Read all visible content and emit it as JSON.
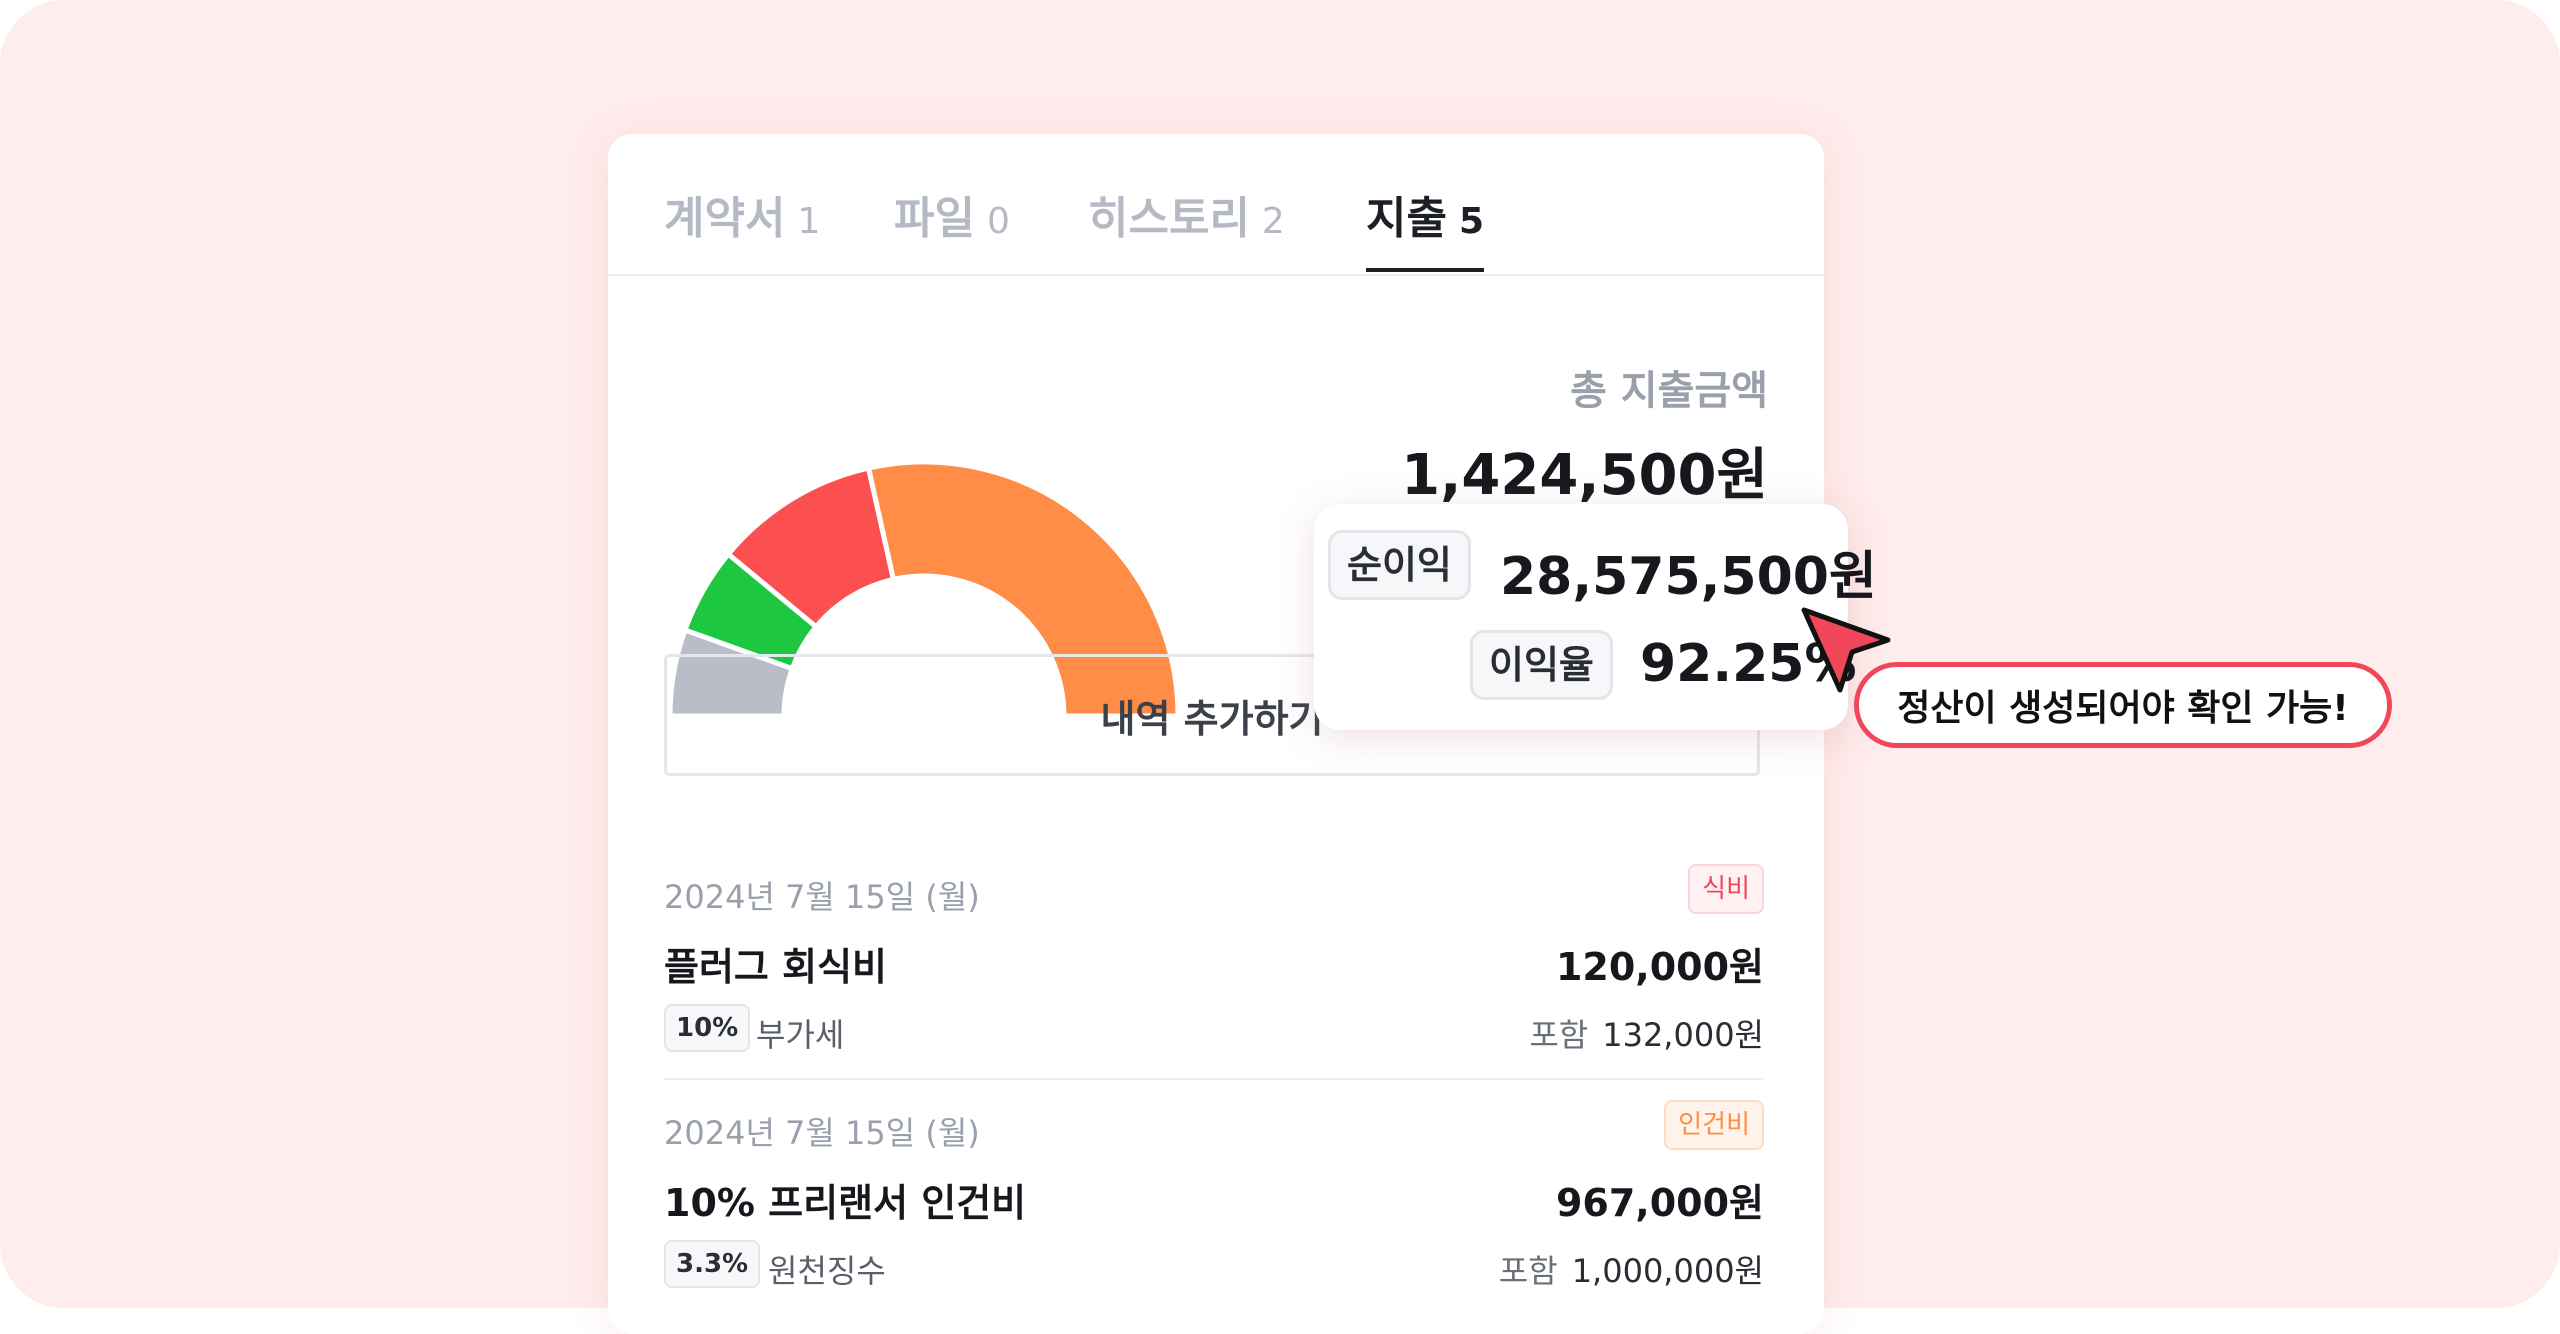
{
  "tabs": [
    {
      "label": "계약서",
      "count": "1"
    },
    {
      "label": "파일",
      "count": "0"
    },
    {
      "label": "히스토리",
      "count": "2"
    },
    {
      "label": "지출",
      "count": "5"
    }
  ],
  "summary": {
    "total_label": "총 지출금액",
    "total_amount": "1,424,500원"
  },
  "chart_data": {
    "type": "pie",
    "style": "half-donut",
    "segments": [
      {
        "color": "#b9bdc8",
        "share": 0.11
      },
      {
        "color": "#1dc73f",
        "share": 0.11
      },
      {
        "color": "#fc5050",
        "share": 0.21
      },
      {
        "color": "#ff8c47",
        "share": 0.57
      }
    ]
  },
  "add_button": {
    "label": "내역 추가하기"
  },
  "expenses": [
    {
      "date": "2024년 7월 15일 (월)",
      "category": "식비",
      "title": "플러그 회식비",
      "amount": "120,000원",
      "rate": "10%",
      "tax_label": "부가세",
      "included_label": "포함",
      "included_amount": "132,000원"
    },
    {
      "date": "2024년 7월 15일 (월)",
      "category": "인건비",
      "title": "10% 프리랜서 인건비",
      "amount": "967,000원",
      "rate": "3.3%",
      "tax_label": "원천징수",
      "included_label": "포함",
      "included_amount": "1,000,000원"
    }
  ],
  "profit_popup": {
    "net_profit_label": "순이익",
    "net_profit_value": "28,575,500원",
    "margin_label": "이익율",
    "margin_value": "92.25%"
  },
  "callout": {
    "text": "정산이 생성되어야 확인 가능!"
  },
  "colors": {
    "background": "#ffecec",
    "food_badge": "#f0485a",
    "labor_badge": "#ff8c47",
    "callout_border": "#f0485a"
  }
}
